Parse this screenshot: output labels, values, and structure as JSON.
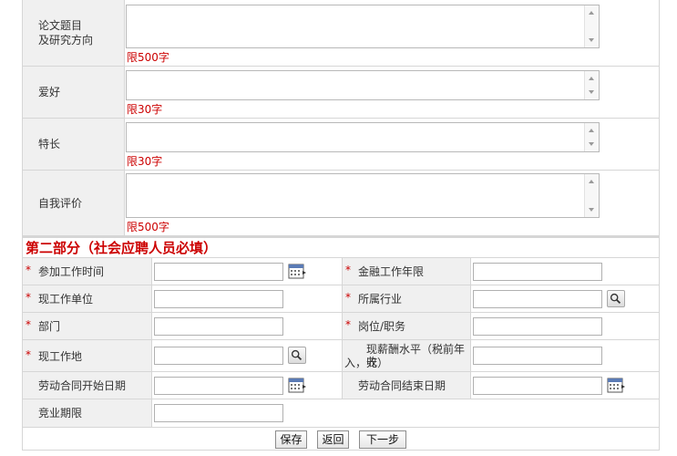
{
  "thesis": {
    "label_line1": "论文题目",
    "label_line2": "及研究方向",
    "limit": "限500字"
  },
  "hobby": {
    "label": "爱好",
    "limit": "限30字"
  },
  "specialty": {
    "label": "特长",
    "limit": "限30字"
  },
  "self_eval": {
    "label": "自我评价",
    "limit": "限500字"
  },
  "section2": {
    "title": "第二部分（社会应聘人员必填）"
  },
  "fields": {
    "start_work_time": "参加工作时间",
    "finance_years": "金融工作年限",
    "current_employer": "现工作单位",
    "industry": "所属行业",
    "department": "部门",
    "position": "岗位/职务",
    "work_location": "现工作地",
    "salary_line1": "现薪酬水平（税前年收",
    "salary_line2": "入，元）",
    "contract_start": "劳动合同开始日期",
    "contract_end": "劳动合同结束日期",
    "non_compete": "竞业期限"
  },
  "required_mark": "*",
  "buttons": {
    "save": "保存",
    "back": "返回",
    "next": "下一步"
  }
}
